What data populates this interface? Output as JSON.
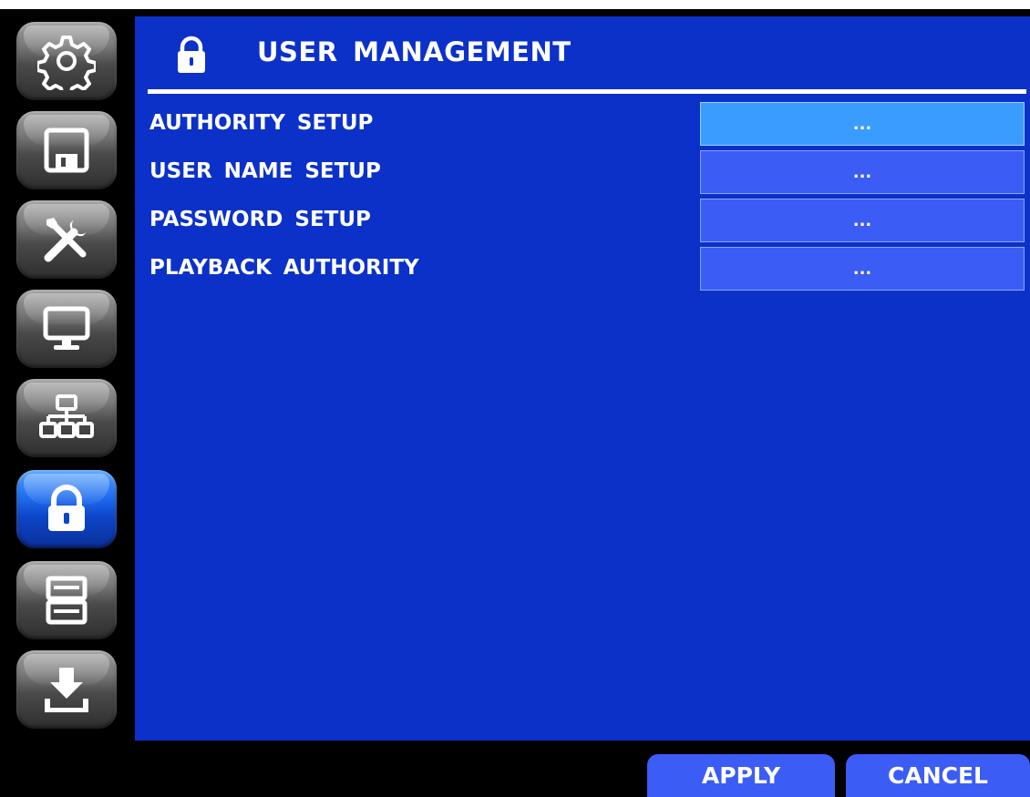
{
  "sidebar": {
    "items": [
      {
        "icon": "gear-icon",
        "active": false
      },
      {
        "icon": "floppy-disk-icon",
        "active": false
      },
      {
        "icon": "tools-icon",
        "active": false
      },
      {
        "icon": "monitor-icon",
        "active": false
      },
      {
        "icon": "network-icon",
        "active": false
      },
      {
        "icon": "lock-icon",
        "active": true
      },
      {
        "icon": "storage-icon",
        "active": false
      },
      {
        "icon": "download-icon",
        "active": false
      }
    ]
  },
  "header": {
    "title": "USER MANAGEMENT",
    "icon": "lock-icon"
  },
  "settings": [
    {
      "label": "AUTHORITY SETUP",
      "value": "...",
      "selected": true
    },
    {
      "label": "USER NAME SETUP",
      "value": "...",
      "selected": false
    },
    {
      "label": "PASSWORD SETUP",
      "value": "...",
      "selected": false
    },
    {
      "label": "PLAYBACK AUTHORITY",
      "value": "...",
      "selected": false
    }
  ],
  "footer": {
    "apply_label": "APPLY",
    "cancel_label": "CANCEL"
  },
  "colors": {
    "panel": "#0b31c9",
    "button": "#3b5cf5",
    "button_selected": "#3b9cff",
    "sidebar_active": "#1f6df0"
  }
}
